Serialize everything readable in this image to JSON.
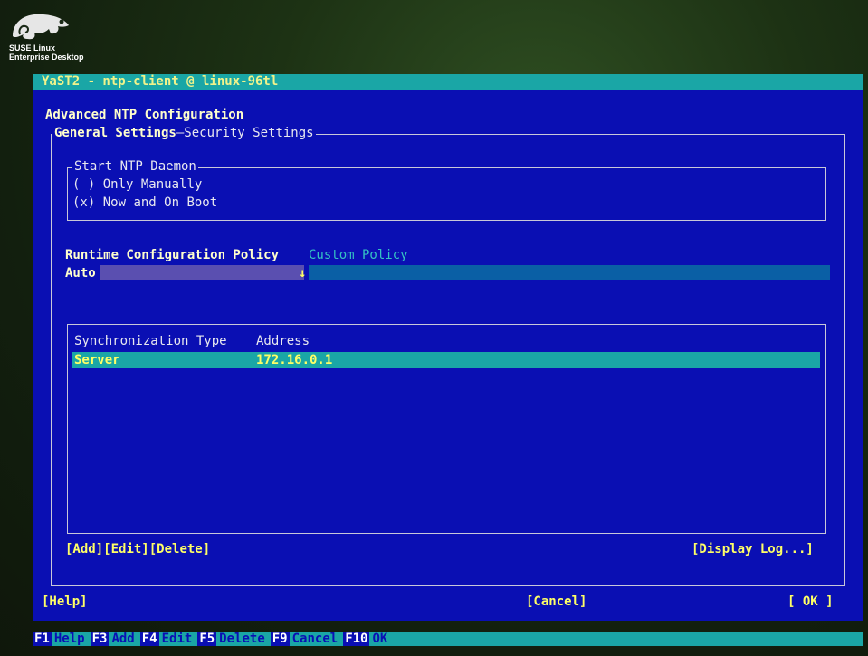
{
  "brand": {
    "line1": "SUSE Linux",
    "line2": "Enterprise Desktop"
  },
  "window": {
    "title": "YaST2 - ntp-client @ linux-96tl"
  },
  "dialog": {
    "heading": "Advanced NTP Configuration",
    "tabs": {
      "general": "General Settings",
      "separator": "—",
      "security": "Security Settings"
    },
    "start_daemon": {
      "legend": "Start NTP Daemon",
      "option_manual": {
        "mark": "( )",
        "label": "Only Manually"
      },
      "option_boot": {
        "mark": "(x)",
        "label": "Now and On Boot"
      }
    },
    "runtime_policy": {
      "label": "Runtime Configuration Policy",
      "custom_label": "Custom Policy",
      "selected": "Auto",
      "arrow": "↓"
    },
    "table": {
      "headers": [
        "Synchronization Type",
        "Address"
      ],
      "rows": [
        [
          "Server",
          "172.16.0.1"
        ]
      ]
    },
    "table_buttons": {
      "add": "[Add]",
      "edit": "[Edit]",
      "delete": "[Delete]",
      "display_log": "[Display Log...]"
    },
    "bottom_buttons": {
      "help": "[Help]",
      "cancel": "[Cancel]",
      "ok": "[ OK ]"
    }
  },
  "function_keys": [
    {
      "key": "F1",
      "label": "Help"
    },
    {
      "key": "F3",
      "label": "Add"
    },
    {
      "key": "F4",
      "label": "Edit"
    },
    {
      "key": "F5",
      "label": "Delete"
    },
    {
      "key": "F9",
      "label": "Cancel"
    },
    {
      "key": "F10",
      "label": "OK"
    }
  ],
  "colors": {
    "dialog_bg": "#0a0fb3",
    "accent": "#1aa6a6",
    "highlight": "#ffff66"
  }
}
